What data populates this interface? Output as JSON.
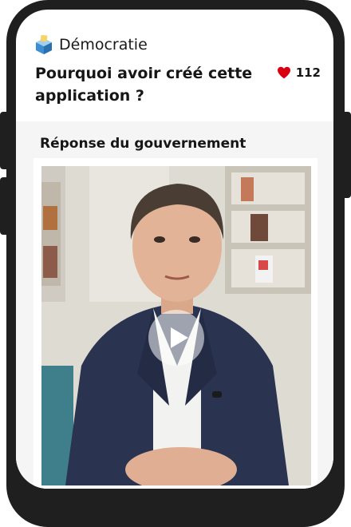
{
  "topic": {
    "label": "Démocratie",
    "icon": "ballot-box-icon"
  },
  "question": {
    "title": "Pourquoi avoir créé cette application ?"
  },
  "likes": {
    "count": "112",
    "icon": "heart-icon",
    "color": "#d90012"
  },
  "response": {
    "title": "Réponse du gouvernement"
  },
  "video": {
    "play_icon": "play-icon"
  }
}
